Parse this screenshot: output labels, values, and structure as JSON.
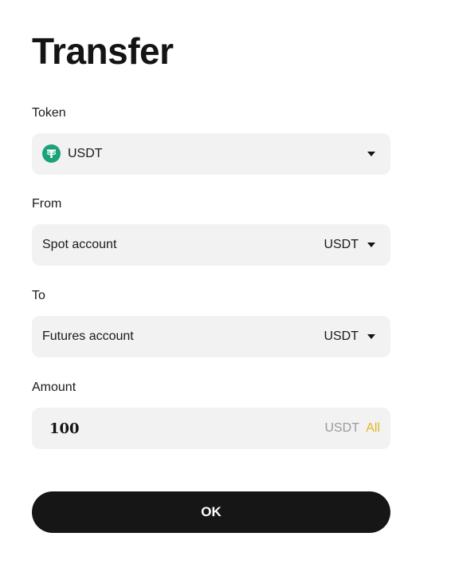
{
  "page": {
    "title": "Transfer"
  },
  "token": {
    "label": "Token",
    "selected": "USDT",
    "icon": "tether-icon",
    "icon_color": "#1ba27a"
  },
  "from": {
    "label": "From",
    "account": "Spot account",
    "currency": "USDT"
  },
  "to": {
    "label": "To",
    "account": "Futures account",
    "currency": "USDT"
  },
  "amount": {
    "label": "Amount",
    "value": "100",
    "unit": "USDT",
    "all_label": "All",
    "all_color": "#e0b622"
  },
  "actions": {
    "ok_label": "OK"
  }
}
